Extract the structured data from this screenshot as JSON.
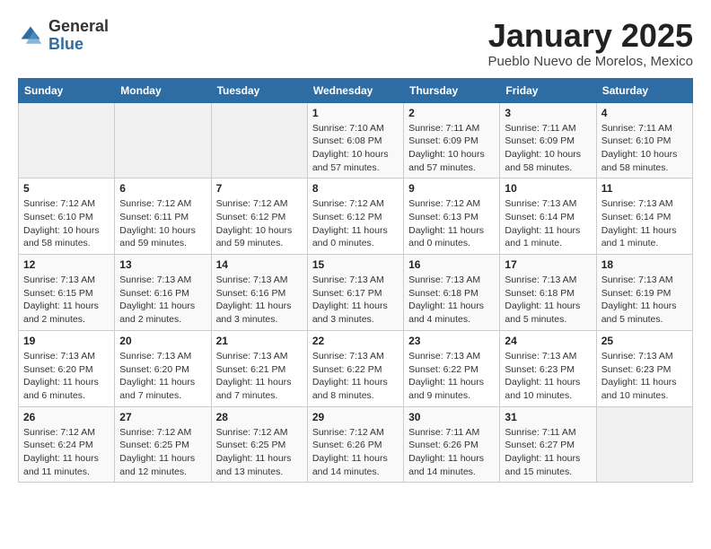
{
  "header": {
    "logo_general": "General",
    "logo_blue": "Blue",
    "month_title": "January 2025",
    "location": "Pueblo Nuevo de Morelos, Mexico"
  },
  "weekdays": [
    "Sunday",
    "Monday",
    "Tuesday",
    "Wednesday",
    "Thursday",
    "Friday",
    "Saturday"
  ],
  "weeks": [
    [
      {
        "day": "",
        "sunrise": "",
        "sunset": "",
        "daylight": ""
      },
      {
        "day": "",
        "sunrise": "",
        "sunset": "",
        "daylight": ""
      },
      {
        "day": "",
        "sunrise": "",
        "sunset": "",
        "daylight": ""
      },
      {
        "day": "1",
        "sunrise": "Sunrise: 7:10 AM",
        "sunset": "Sunset: 6:08 PM",
        "daylight": "Daylight: 10 hours and 57 minutes."
      },
      {
        "day": "2",
        "sunrise": "Sunrise: 7:11 AM",
        "sunset": "Sunset: 6:09 PM",
        "daylight": "Daylight: 10 hours and 57 minutes."
      },
      {
        "day": "3",
        "sunrise": "Sunrise: 7:11 AM",
        "sunset": "Sunset: 6:09 PM",
        "daylight": "Daylight: 10 hours and 58 minutes."
      },
      {
        "day": "4",
        "sunrise": "Sunrise: 7:11 AM",
        "sunset": "Sunset: 6:10 PM",
        "daylight": "Daylight: 10 hours and 58 minutes."
      }
    ],
    [
      {
        "day": "5",
        "sunrise": "Sunrise: 7:12 AM",
        "sunset": "Sunset: 6:10 PM",
        "daylight": "Daylight: 10 hours and 58 minutes."
      },
      {
        "day": "6",
        "sunrise": "Sunrise: 7:12 AM",
        "sunset": "Sunset: 6:11 PM",
        "daylight": "Daylight: 10 hours and 59 minutes."
      },
      {
        "day": "7",
        "sunrise": "Sunrise: 7:12 AM",
        "sunset": "Sunset: 6:12 PM",
        "daylight": "Daylight: 10 hours and 59 minutes."
      },
      {
        "day": "8",
        "sunrise": "Sunrise: 7:12 AM",
        "sunset": "Sunset: 6:12 PM",
        "daylight": "Daylight: 11 hours and 0 minutes."
      },
      {
        "day": "9",
        "sunrise": "Sunrise: 7:12 AM",
        "sunset": "Sunset: 6:13 PM",
        "daylight": "Daylight: 11 hours and 0 minutes."
      },
      {
        "day": "10",
        "sunrise": "Sunrise: 7:13 AM",
        "sunset": "Sunset: 6:14 PM",
        "daylight": "Daylight: 11 hours and 1 minute."
      },
      {
        "day": "11",
        "sunrise": "Sunrise: 7:13 AM",
        "sunset": "Sunset: 6:14 PM",
        "daylight": "Daylight: 11 hours and 1 minute."
      }
    ],
    [
      {
        "day": "12",
        "sunrise": "Sunrise: 7:13 AM",
        "sunset": "Sunset: 6:15 PM",
        "daylight": "Daylight: 11 hours and 2 minutes."
      },
      {
        "day": "13",
        "sunrise": "Sunrise: 7:13 AM",
        "sunset": "Sunset: 6:16 PM",
        "daylight": "Daylight: 11 hours and 2 minutes."
      },
      {
        "day": "14",
        "sunrise": "Sunrise: 7:13 AM",
        "sunset": "Sunset: 6:16 PM",
        "daylight": "Daylight: 11 hours and 3 minutes."
      },
      {
        "day": "15",
        "sunrise": "Sunrise: 7:13 AM",
        "sunset": "Sunset: 6:17 PM",
        "daylight": "Daylight: 11 hours and 3 minutes."
      },
      {
        "day": "16",
        "sunrise": "Sunrise: 7:13 AM",
        "sunset": "Sunset: 6:18 PM",
        "daylight": "Daylight: 11 hours and 4 minutes."
      },
      {
        "day": "17",
        "sunrise": "Sunrise: 7:13 AM",
        "sunset": "Sunset: 6:18 PM",
        "daylight": "Daylight: 11 hours and 5 minutes."
      },
      {
        "day": "18",
        "sunrise": "Sunrise: 7:13 AM",
        "sunset": "Sunset: 6:19 PM",
        "daylight": "Daylight: 11 hours and 5 minutes."
      }
    ],
    [
      {
        "day": "19",
        "sunrise": "Sunrise: 7:13 AM",
        "sunset": "Sunset: 6:20 PM",
        "daylight": "Daylight: 11 hours and 6 minutes."
      },
      {
        "day": "20",
        "sunrise": "Sunrise: 7:13 AM",
        "sunset": "Sunset: 6:20 PM",
        "daylight": "Daylight: 11 hours and 7 minutes."
      },
      {
        "day": "21",
        "sunrise": "Sunrise: 7:13 AM",
        "sunset": "Sunset: 6:21 PM",
        "daylight": "Daylight: 11 hours and 7 minutes."
      },
      {
        "day": "22",
        "sunrise": "Sunrise: 7:13 AM",
        "sunset": "Sunset: 6:22 PM",
        "daylight": "Daylight: 11 hours and 8 minutes."
      },
      {
        "day": "23",
        "sunrise": "Sunrise: 7:13 AM",
        "sunset": "Sunset: 6:22 PM",
        "daylight": "Daylight: 11 hours and 9 minutes."
      },
      {
        "day": "24",
        "sunrise": "Sunrise: 7:13 AM",
        "sunset": "Sunset: 6:23 PM",
        "daylight": "Daylight: 11 hours and 10 minutes."
      },
      {
        "day": "25",
        "sunrise": "Sunrise: 7:13 AM",
        "sunset": "Sunset: 6:23 PM",
        "daylight": "Daylight: 11 hours and 10 minutes."
      }
    ],
    [
      {
        "day": "26",
        "sunrise": "Sunrise: 7:12 AM",
        "sunset": "Sunset: 6:24 PM",
        "daylight": "Daylight: 11 hours and 11 minutes."
      },
      {
        "day": "27",
        "sunrise": "Sunrise: 7:12 AM",
        "sunset": "Sunset: 6:25 PM",
        "daylight": "Daylight: 11 hours and 12 minutes."
      },
      {
        "day": "28",
        "sunrise": "Sunrise: 7:12 AM",
        "sunset": "Sunset: 6:25 PM",
        "daylight": "Daylight: 11 hours and 13 minutes."
      },
      {
        "day": "29",
        "sunrise": "Sunrise: 7:12 AM",
        "sunset": "Sunset: 6:26 PM",
        "daylight": "Daylight: 11 hours and 14 minutes."
      },
      {
        "day": "30",
        "sunrise": "Sunrise: 7:11 AM",
        "sunset": "Sunset: 6:26 PM",
        "daylight": "Daylight: 11 hours and 14 minutes."
      },
      {
        "day": "31",
        "sunrise": "Sunrise: 7:11 AM",
        "sunset": "Sunset: 6:27 PM",
        "daylight": "Daylight: 11 hours and 15 minutes."
      },
      {
        "day": "",
        "sunrise": "",
        "sunset": "",
        "daylight": ""
      }
    ]
  ]
}
